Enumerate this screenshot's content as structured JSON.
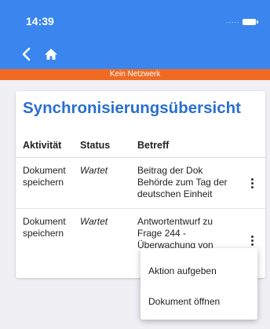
{
  "status_bar": {
    "time": "14:39",
    "signal": "....."
  },
  "banner": {
    "text": "Kein Netzwerk"
  },
  "page": {
    "title": "Synchronisierungsübersicht"
  },
  "table": {
    "headers": [
      "Aktivität",
      "Status",
      "Betreff"
    ],
    "rows": [
      {
        "activity": [
          "Dokument",
          "speichern"
        ],
        "status": "Wartet",
        "subject": [
          "Beitrag der Dok",
          "Behörde zum Tag der",
          "deutschen Einheit"
        ]
      },
      {
        "activity": [
          "Dokument",
          "speichern"
        ],
        "status": "Wartet",
        "subject": [
          "Antwortentwurf zu",
          "Frage 244 -",
          "Überwachung von"
        ]
      }
    ]
  },
  "menu": {
    "items": [
      "Aktion aufgeben",
      "Dokument öffnen"
    ]
  },
  "colors": {
    "primary": "#3a86ee",
    "title": "#2a6fd0",
    "banner": "#f06a22"
  }
}
